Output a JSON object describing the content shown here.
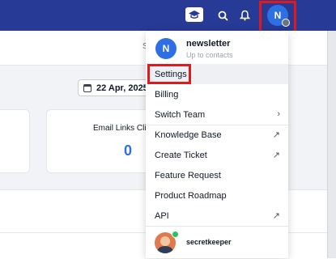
{
  "header": {
    "user_initial": "N",
    "icons": [
      "graduation-cap-icon",
      "search-icon",
      "bell-icon"
    ],
    "subbar_stub": "S"
  },
  "dashboard": {
    "date_range": "22 Apr, 2025",
    "card_email_links_label": "Email Links Cli",
    "card_email_links_value": "0"
  },
  "menu": {
    "account_initial": "N",
    "account_name": "newsletter",
    "account_sub": "Up to contacts",
    "items": [
      {
        "label": "Settings",
        "arrow": ""
      },
      {
        "label": "Billing",
        "arrow": ""
      },
      {
        "label": "Switch Team",
        "arrow": "›"
      },
      {
        "label": "Knowledge Base",
        "arrow": "↗"
      },
      {
        "label": "Create Ticket",
        "arrow": "↗"
      },
      {
        "label": "Feature Request",
        "arrow": ""
      },
      {
        "label": "Product Roadmap",
        "arrow": ""
      },
      {
        "label": "API",
        "arrow": "↗"
      }
    ],
    "footer_user": "secretkeeper"
  },
  "colors": {
    "topbar": "#263a96",
    "accent": "#2f6fe4",
    "highlight": "#e0191c"
  }
}
